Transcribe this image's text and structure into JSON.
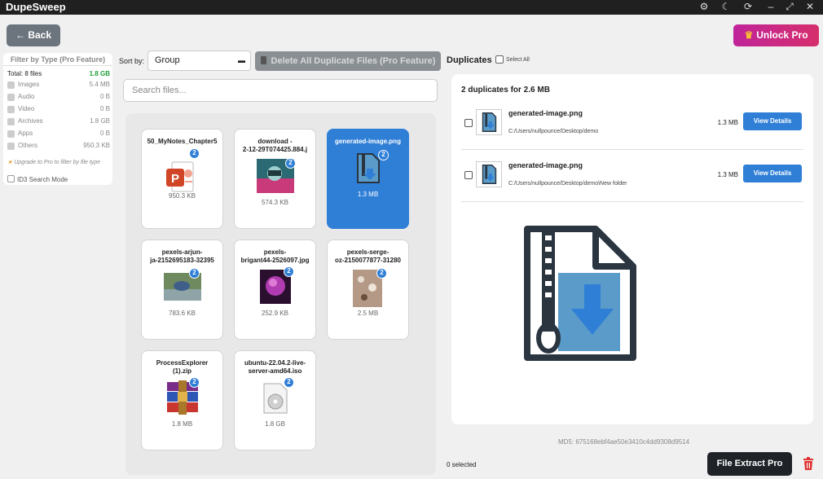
{
  "app": {
    "title": "DupeSweep",
    "window_controls": [
      "gear-icon",
      "moon-icon",
      "refresh-icon",
      "expand-icon",
      "close-icon"
    ]
  },
  "header": {
    "back_label": "← Back",
    "unlock_label": "Unlock Pro"
  },
  "filter": {
    "title": "Filter by Type (Pro Feature)",
    "total_label": "Total: 8 files",
    "total_size": "1.8 GB",
    "rows": [
      {
        "label": "Images",
        "size": "5.4 MB"
      },
      {
        "label": "Audio",
        "size": "0 B"
      },
      {
        "label": "Video",
        "size": "0 B"
      },
      {
        "label": "Archives",
        "size": "1.8 GB"
      },
      {
        "label": "Apps",
        "size": "0 B"
      },
      {
        "label": "Others",
        "size": "950.3 KB"
      }
    ],
    "upgrade_note": "Upgrade to Pro to filter by file type",
    "id3_label": "ID3 Search Mode"
  },
  "toolbar": {
    "sort_label": "Sort by:",
    "sort_value": "Group",
    "delete_all_label": "Delete All Duplicate Files (Pro Feature)",
    "search_placeholder": "Search files..."
  },
  "files": [
    {
      "name": "50_MyNotes_Chapter5",
      "size": "950.3 KB",
      "count": "2",
      "icon": "powerpoint-icon"
    },
    {
      "name": "download -\n2-12-29T074425.884.j",
      "size": "574.3 KB",
      "count": "2",
      "icon": "image-thumbnail"
    },
    {
      "name": "generated-image.png",
      "size": "1.3 MB",
      "count": "2",
      "icon": "zip-file-icon",
      "selected": true
    },
    {
      "name": "pexels-arjun-\nja-2152695183-32395",
      "size": "783.6 KB",
      "count": "2",
      "icon": "image-thumbnail"
    },
    {
      "name": "pexels-\nbrigant44-2526097.jpg",
      "size": "252.9 KB",
      "count": "2",
      "icon": "image-thumbnail"
    },
    {
      "name": "pexels-serge-\noz-2150077877-31280",
      "size": "2.5 MB",
      "count": "2",
      "icon": "image-thumbnail"
    },
    {
      "name": "ProcessExplorer\n(1).zip",
      "size": "1.8 MB",
      "count": "2",
      "icon": "winrar-icon"
    },
    {
      "name": "ubuntu-22.04.2-live-\nserver-amd64.iso",
      "size": "1.8 GB",
      "count": "2",
      "icon": "disc-icon"
    }
  ],
  "duplicates": {
    "title": "Duplicates",
    "select_all_label": "Select All",
    "count_label": "2 duplicates for 2.6 MB",
    "items": [
      {
        "name": "generated-image.png",
        "path": "C:/Users/nullpounce/Desktop/demo",
        "size": "1.3 MB",
        "button": "View Details"
      },
      {
        "name": "generated-image.png",
        "path": "C:/Users/nullpounce/Desktop/demo\\New folder",
        "size": "1.3 MB",
        "button": "View Details"
      }
    ],
    "md5": "MD5: 675168ebf4ae50e3410c4dd9308d9514"
  },
  "footer": {
    "selected_label": "0 selected",
    "extract_label": "File Extract Pro"
  },
  "colors": {
    "accent": "#2f7fd7",
    "titlebar": "#202020",
    "unlock_gradient_start": "#c0249a",
    "unlock_gradient_end": "#d62e6c",
    "total_size_green": "#1e9e3a",
    "delete_red": "#e03030"
  }
}
